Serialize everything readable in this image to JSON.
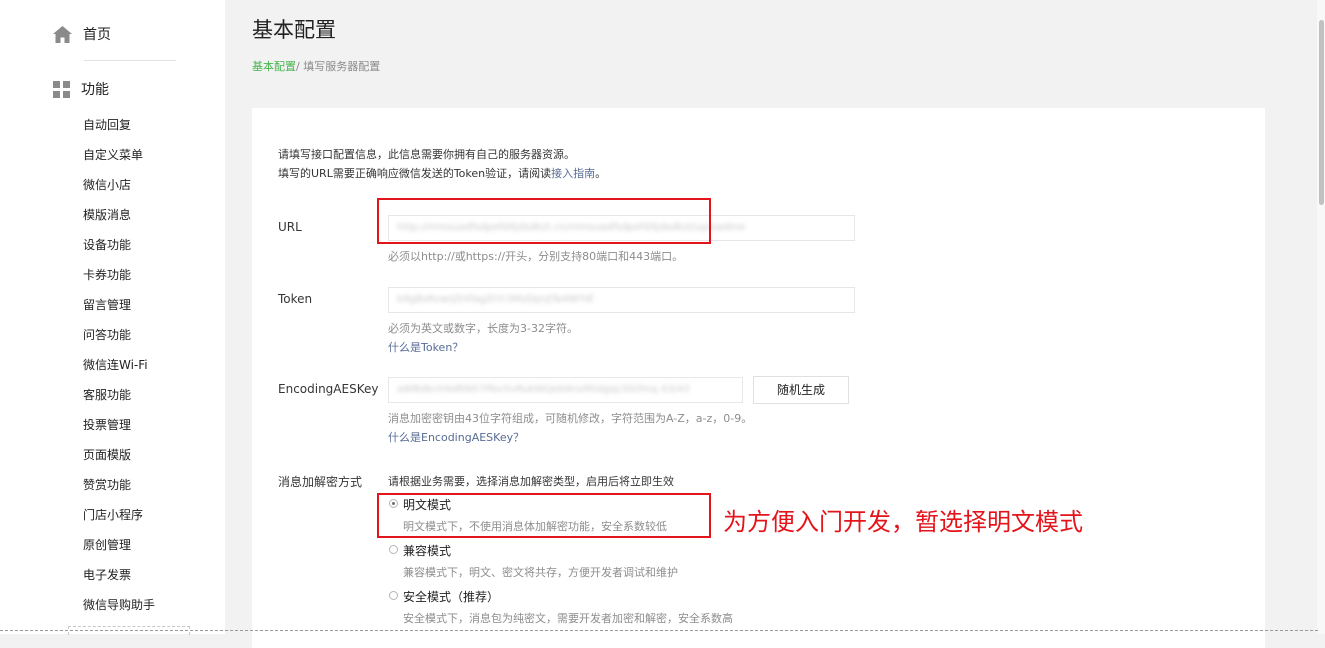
{
  "sidebar": {
    "home_label": "首页",
    "func_label": "功能",
    "items": [
      "自动回复",
      "自定义菜单",
      "微信小店",
      "模版消息",
      "设备功能",
      "卡券功能",
      "留言管理",
      "问答功能",
      "微信连Wi-Fi",
      "客服功能",
      "投票管理",
      "页面模版",
      "赞赏功能",
      "门店小程序",
      "原创管理",
      "电子发票",
      "微信导购助手"
    ]
  },
  "header": {
    "title": "基本配置",
    "breadcrumb_home": "基本配置",
    "breadcrumb_current": "/ 填写服务器配置"
  },
  "intro": {
    "line1": "请填写接口配置信息，此信息需要你拥有自己的服务器资源。",
    "line2_prefix": "填写的URL需要正确响应微信发送的Token验证，请阅读",
    "line2_link": "接入指南",
    "line2_suffix": "。"
  },
  "form": {
    "url": {
      "label": "URL",
      "value": "http://mmsuadfsdpefd4jdsdkzt.cn/mmsuadfsdpefd4jdsdkzt/uploadme",
      "tip": "必须以http://或https://开头，分别支持80端口和443端口。"
    },
    "token": {
      "label": "Token",
      "value": "k9gBsRxwQ5XfagZtYr3MzDpUjTa4NFhE",
      "tip": "必须为英文或数字，长度为3-32字符。",
      "help": "什么是Token？"
    },
    "aes": {
      "label": "EncodingAESKey",
      "value": "aWBdkcH4dRN57PbvXvRukWQeb9nxRhdgqz3iGfmq 43/43",
      "button": "随机生成",
      "tip": "消息加密密钥由43位字符组成，可随机修改，字符范围为A-Z，a-z，0-9。",
      "help": "什么是EncodingAESKey？"
    },
    "encrypt": {
      "label": "消息加解密方式",
      "tip": "请根据业务需要，选择消息加解密类型，启用后将立即生效",
      "options": [
        {
          "label": "明文模式",
          "desc": "明文模式下，不使用消息体加解密功能，安全系数较低",
          "selected": true
        },
        {
          "label": "兼容模式",
          "desc": "兼容模式下，明文、密文将共存，方便开发者调试和维护",
          "selected": false
        },
        {
          "label": "安全模式（推荐）",
          "desc": "安全模式下，消息包为纯密文，需要开发者加密和解密，安全系数高",
          "selected": false
        }
      ]
    }
  },
  "annotation": "为方便入门开发，暂选择明文模式",
  "colors": {
    "accent_green": "#44b549",
    "link_blue": "#576b95",
    "annotation_red": "#e4141b"
  },
  "icons": [
    "home-icon",
    "grid-icon"
  ]
}
